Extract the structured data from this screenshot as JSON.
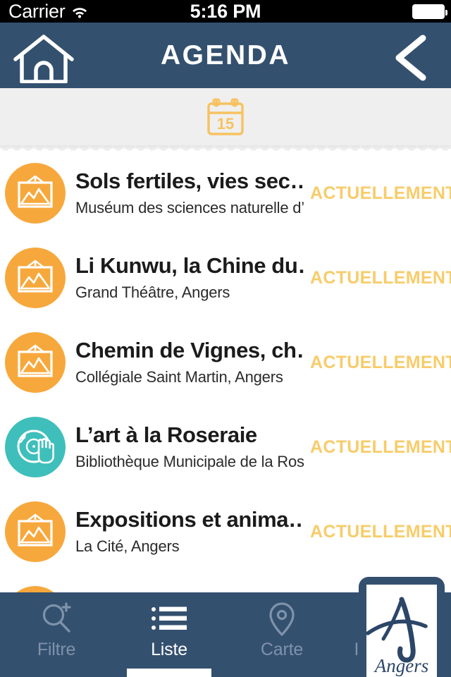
{
  "theme": {
    "navy": "#34506f",
    "orange": "#f7a83c",
    "teal": "#3ebfbb",
    "status_yellow": "#f7cc6a",
    "strip_gray": "#efefef",
    "tab_inactive": "#7e92aa"
  },
  "statusbar": {
    "carrier": "Carrier",
    "wifi_icon": "wifi-icon",
    "time": "5:16 PM",
    "battery_icon": "battery-icon"
  },
  "header": {
    "title": "AGENDA",
    "home_icon": "home-icon",
    "back_icon": "chevron-left-icon"
  },
  "datestrip": {
    "calendar_icon": "calendar-icon",
    "day": "15"
  },
  "list": {
    "items": [
      {
        "title": "Sols fertiles, vies sec…",
        "subtitle": "Muséum des sciences naturelle d’A…",
        "status": "ACTUELLEMENT",
        "icon": "picture-frame-icon",
        "icon_color": "#f7a83c"
      },
      {
        "title": "Li Kunwu, la Chine du…",
        "subtitle": "Grand Théâtre, Angers",
        "status": "ACTUELLEMENT",
        "icon": "picture-frame-icon",
        "icon_color": "#f7a83c"
      },
      {
        "title": "Chemin de Vignes, ch…",
        "subtitle": "Collégiale Saint Martin, Angers",
        "status": "ACTUELLEMENT",
        "icon": "picture-frame-icon",
        "icon_color": "#f7a83c"
      },
      {
        "title": "L’art à la Roseraie",
        "subtitle": "Bibliothèque Municipale de la Rose…",
        "status": "ACTUELLEMENT",
        "icon": "vinyl-record-hand-icon",
        "icon_color": "#3ebfbb"
      },
      {
        "title": "Expositions et anima…",
        "subtitle": "La Cité, Angers",
        "status": "ACTUELLEMENT",
        "icon": "picture-frame-icon",
        "icon_color": "#f7a83c"
      },
      {
        "title": "",
        "subtitle": "",
        "status": "",
        "icon": "picture-frame-icon",
        "icon_color": "#f7a83c"
      }
    ]
  },
  "tabbar": {
    "tabs": [
      {
        "label": "Filtre",
        "icon": "search-plus-icon",
        "active": false
      },
      {
        "label": "Liste",
        "icon": "list-lines-icon",
        "active": true
      },
      {
        "label": "Carte",
        "icon": "map-pin-icon",
        "active": false
      },
      {
        "label": "Immersion",
        "icon": "glasses-3d-icon",
        "active": false
      }
    ],
    "logo": {
      "name": "angers-logo",
      "wordmark": "Angers"
    }
  }
}
